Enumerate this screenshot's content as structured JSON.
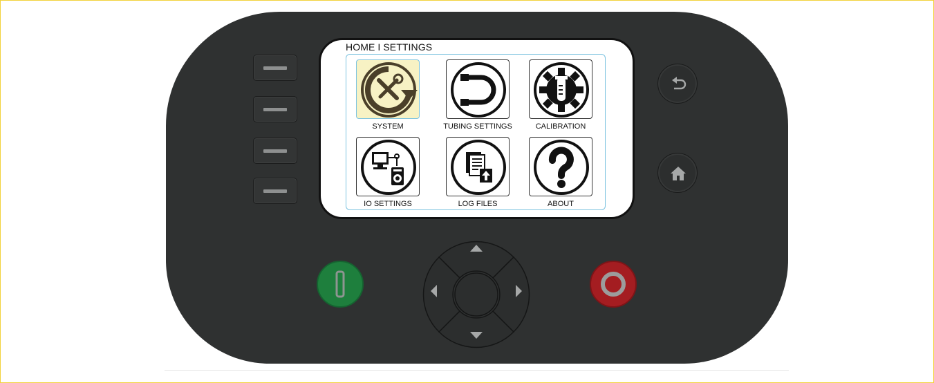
{
  "screen": {
    "breadcrumb": "HOME I SETTINGS",
    "tiles": [
      {
        "label": "SYSTEM",
        "icon": "system-tools-icon",
        "selected": true
      },
      {
        "label": "TUBING SETTINGS",
        "icon": "tubing-icon",
        "selected": false
      },
      {
        "label": "CALIBRATION",
        "icon": "calibration-gear-icon",
        "selected": false
      },
      {
        "label": "IO SETTINGS",
        "icon": "io-computer-device-icon",
        "selected": false
      },
      {
        "label": "LOG FILES",
        "icon": "log-files-upload-icon",
        "selected": false
      },
      {
        "label": "ABOUT",
        "icon": "question-mark-icon",
        "selected": false
      }
    ]
  },
  "hardware": {
    "soft_keys": [
      "soft-key-1",
      "soft-key-2",
      "soft-key-3",
      "soft-key-4"
    ],
    "back_icon": "back-arrow-icon",
    "home_icon": "home-icon",
    "start_icon": "start-power-i-icon",
    "stop_icon": "stop-power-o-icon",
    "dpad_icons": [
      "arrow-up-icon",
      "arrow-down-icon",
      "arrow-left-icon",
      "arrow-right-icon"
    ]
  },
  "colors": {
    "panel": "#2f3131",
    "selected_tile": "#f7f2c4",
    "tile_border_highlight": "#7cc3e0",
    "icon_dark": "#111111",
    "system_icon_brown": "#4a3f29",
    "start_green": "#1e7f3d",
    "stop_red": "#a41d21"
  }
}
